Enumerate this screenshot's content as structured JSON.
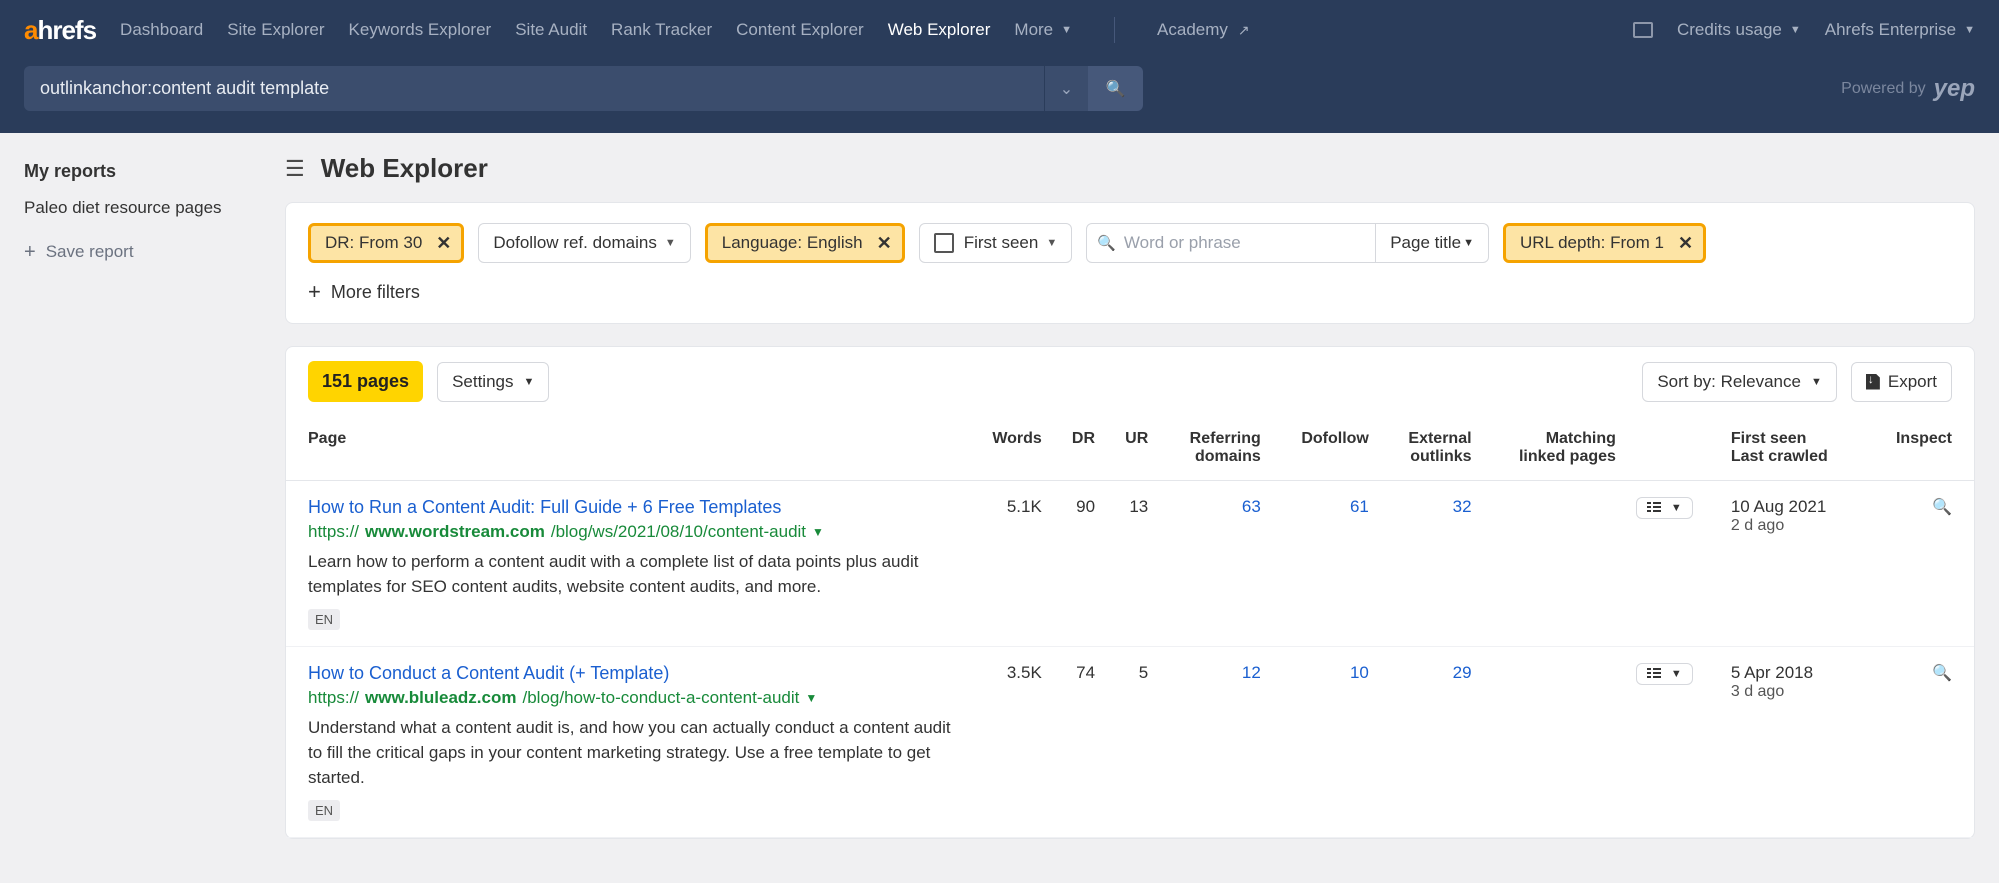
{
  "topnav": {
    "logo_a": "a",
    "logo_rest": "hrefs",
    "items": [
      "Dashboard",
      "Site Explorer",
      "Keywords Explorer",
      "Site Audit",
      "Rank Tracker",
      "Content Explorer",
      "Web Explorer",
      "More"
    ],
    "active_index": 6,
    "academy": "Academy",
    "credits": "Credits usage",
    "account": "Ahrefs Enterprise"
  },
  "search": {
    "value": "outlinkanchor:content audit template",
    "powered": "Powered by",
    "yep": "yep"
  },
  "sidebar": {
    "heading": "My reports",
    "report": "Paleo diet resource pages",
    "save": "Save report"
  },
  "page": {
    "title": "Web Explorer"
  },
  "filters": {
    "dr": "DR: From 30",
    "dofollow": "Dofollow ref. domains",
    "language": "Language: English",
    "first_seen": "First seen",
    "word_placeholder": "Word or phrase",
    "page_title": "Page title",
    "url_depth": "URL depth: From 1",
    "more": "More filters"
  },
  "results": {
    "count": "151 pages",
    "settings": "Settings",
    "sort": "Sort by: Relevance",
    "export": "Export",
    "columns": {
      "page": "Page",
      "words": "Words",
      "dr": "DR",
      "ur": "UR",
      "refdom1": "Referring",
      "refdom2": "domains",
      "dofollow": "Dofollow",
      "external1": "External",
      "external2": "outlinks",
      "mlp1": "Matching",
      "mlp2": "linked pages",
      "fs1": "First seen",
      "fs2": "Last crawled",
      "inspect": "Inspect"
    },
    "rows": [
      {
        "title": "How to Run a Content Audit: Full Guide + 6 Free Templates",
        "url_proto": "https://",
        "url_domain": "www.wordstream.com",
        "url_path": "/blog/ws/2021/08/10/content-audit",
        "desc": "Learn how to perform a content audit with a complete list of data points plus audit templates for SEO content audits, website content audits, and more.",
        "lang": "EN",
        "words": "5.1K",
        "dr": "90",
        "ur": "13",
        "refdom": "63",
        "dofollow": "61",
        "external": "32",
        "first_seen": "10 Aug 2021",
        "last_crawled": "2 d ago"
      },
      {
        "title": "How to Conduct a Content Audit (+ Template)",
        "url_proto": "https://",
        "url_domain": "www.bluleadz.com",
        "url_path": "/blog/how-to-conduct-a-content-audit",
        "desc": "Understand what a content audit is, and how you can actually conduct a content audit to fill the critical gaps in your content marketing strategy. Use a free template to get started.",
        "lang": "EN",
        "words": "3.5K",
        "dr": "74",
        "ur": "5",
        "refdom": "12",
        "dofollow": "10",
        "external": "29",
        "first_seen": "5 Apr 2018",
        "last_crawled": "3 d ago"
      }
    ]
  }
}
